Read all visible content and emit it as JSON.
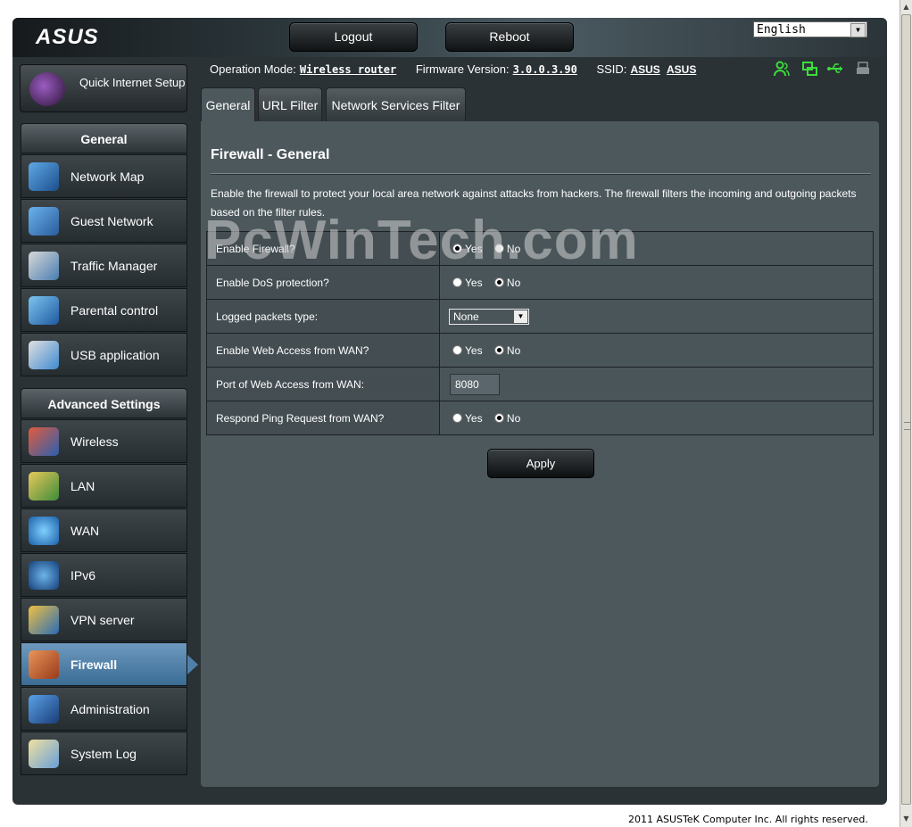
{
  "header": {
    "logo": "ASUS",
    "logout_label": "Logout",
    "reboot_label": "Reboot",
    "language": "English"
  },
  "status": {
    "operation_mode_label": "Operation Mode:",
    "operation_mode_value": "Wireless router",
    "firmware_label": "Firmware Version:",
    "firmware_value": "3.0.0.3.90",
    "ssid_label": "SSID:",
    "ssid_values": [
      "ASUS",
      "ASUS"
    ],
    "icons": [
      "clients-icon",
      "network-status-icon",
      "usb-icon",
      "printer-icon"
    ]
  },
  "sidebar": {
    "quick_setup_label": "Quick Internet Setup",
    "general_header": "General",
    "general_items": [
      {
        "label": "Network Map",
        "icon": "network-map-icon"
      },
      {
        "label": "Guest Network",
        "icon": "guest-network-icon"
      },
      {
        "label": "Traffic Manager",
        "icon": "traffic-manager-icon"
      },
      {
        "label": "Parental control",
        "icon": "parental-control-icon"
      },
      {
        "label": "USB application",
        "icon": "usb-application-icon"
      }
    ],
    "advanced_header": "Advanced Settings",
    "advanced_items": [
      {
        "label": "Wireless",
        "icon": "wireless-icon"
      },
      {
        "label": "LAN",
        "icon": "lan-icon"
      },
      {
        "label": "WAN",
        "icon": "wan-icon"
      },
      {
        "label": "IPv6",
        "icon": "ipv6-icon"
      },
      {
        "label": "VPN server",
        "icon": "vpn-server-icon"
      },
      {
        "label": "Firewall",
        "icon": "firewall-icon",
        "active": true
      },
      {
        "label": "Administration",
        "icon": "administration-icon"
      },
      {
        "label": "System Log",
        "icon": "system-log-icon"
      }
    ]
  },
  "tabs": [
    {
      "label": "General",
      "active": true
    },
    {
      "label": "URL Filter"
    },
    {
      "label": "Network Services Filter"
    }
  ],
  "content": {
    "title": "Firewall - General",
    "description": "Enable the firewall to protect your local area network against attacks from hackers. The firewall filters the incoming and outgoing packets based on the filter rules.",
    "yes_label": "Yes",
    "no_label": "No",
    "rows": {
      "enable_firewall": {
        "label": "Enable Firewall?",
        "value": "Yes"
      },
      "enable_dos": {
        "label": "Enable DoS protection?",
        "value": "No"
      },
      "logged_packets": {
        "label": "Logged packets type:",
        "value": "None"
      },
      "web_access_wan": {
        "label": "Enable Web Access from WAN?",
        "value": "No"
      },
      "web_access_port": {
        "label": "Port of Web Access from WAN:",
        "value": "8080"
      },
      "ping_wan": {
        "label": "Respond Ping Request from WAN?",
        "value": "No"
      }
    },
    "apply_label": "Apply"
  },
  "watermark": "PcWinTech.com",
  "footer": "2011 ASUSTeK Computer Inc. All rights reserved.",
  "colors": {
    "active_item": "#4f80aa",
    "status_icons": "#3cdc3c",
    "panel_bg": "#4d585d"
  }
}
